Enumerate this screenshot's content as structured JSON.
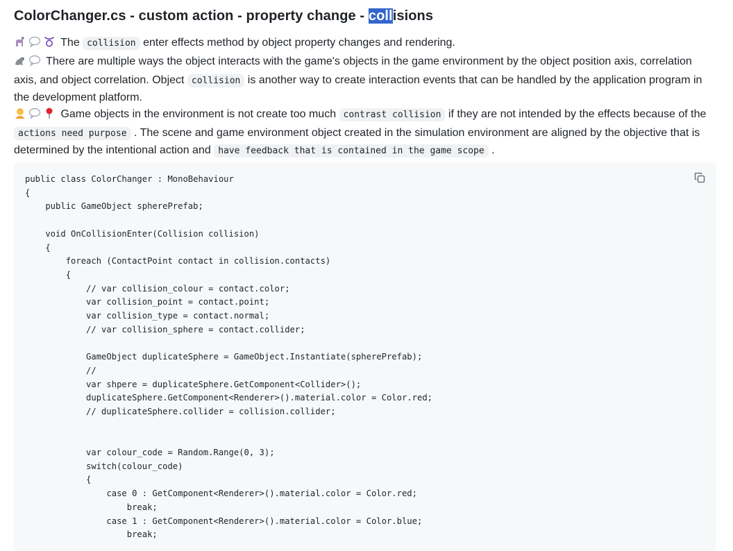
{
  "title": {
    "prefix": "ColorChanger.cs - custom action - property change - ",
    "highlighted": "coll",
    "suffix": "isions"
  },
  "lines": [
    {
      "text_1": "The ",
      "code_1": "collision",
      "text_2": " enter effects method by object property changes and rendering."
    },
    {
      "text_1": "There are multiple ways the object interacts with the game's objects in the game environment by the object position axis, correlation axis, and object correlation. Object ",
      "code_1": "collision",
      "text_2": " is another way to create interaction events that can be handled by the application program in the development platform."
    },
    {
      "text_1": "Game objects in the environment is not create too much ",
      "code_1": "contrast collision",
      "text_2": " if they are not intended by the effects because of the ",
      "code_2": "actions need purpose",
      "text_3": " . The scene and game environment object created in the simulation environment are aligned by the objective that is determined by the intentional action and ",
      "code_3": "have feedback that is contained in the game scope",
      "text_4": " ."
    }
  ],
  "icons": [
    "llama-icon",
    "speech-bubble-icon",
    "taurus-icon",
    "seal-icon",
    "person-icon",
    "pushpin-icon",
    "copy-icon"
  ],
  "code_block": {
    "language": "C#",
    "text": "public class ColorChanger : MonoBehaviour\n{\n    public GameObject spherePrefab;\n\n    void OnCollisionEnter(Collision collision)\n    {\n        foreach (ContactPoint contact in collision.contacts)\n        {\n            // var collision_colour = contact.color;\n            var collision_point = contact.point;\n            var collision_type = contact.normal;\n            // var collision_sphere = contact.collider;\n\n            GameObject duplicateSphere = GameObject.Instantiate(spherePrefab);\n            //\n            var shpere = duplicateSphere.GetComponent<Collider>();\n            duplicateSphere.GetComponent<Renderer>().material.color = Color.red;\n            // duplicateSphere.collider = collision.collider;\n\n\n            var colour_code = Random.Range(0, 3);\n            switch(colour_code)\n            {\n                case 0 : GetComponent<Renderer>().material.color = Color.red;\n                    break;\n                case 1 : GetComponent<Renderer>().material.color = Color.blue;\n                    break;"
  }
}
